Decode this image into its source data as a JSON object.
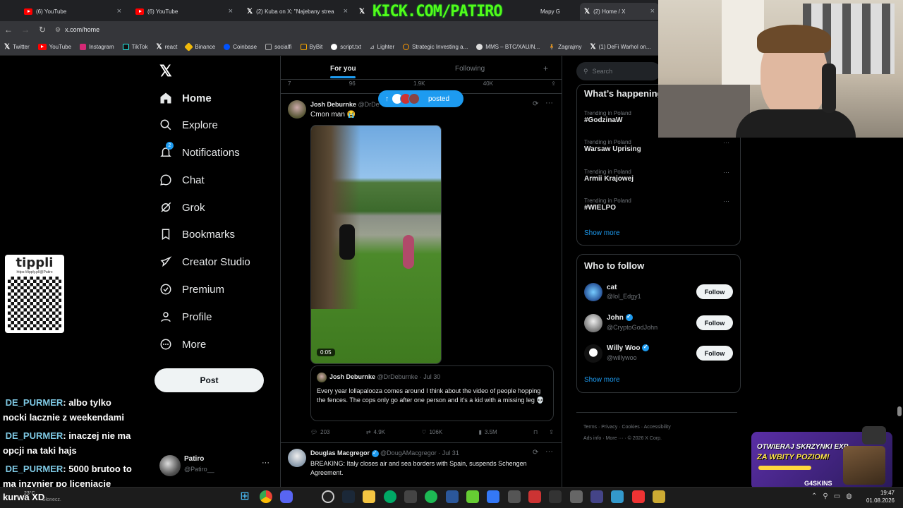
{
  "browser": {
    "tabs": [
      {
        "label": "(6) YouTube",
        "type": "youtube"
      },
      {
        "label": "(6) YouTube",
        "type": "youtube"
      },
      {
        "label": "(2) Kuba on X: \"Najebany strea",
        "type": "x"
      },
      {
        "label": "(2) Home / X",
        "type": "x"
      }
    ],
    "tab_partial_text": "Mapy G",
    "kick_overlay": "KICK.COM/PATIRO",
    "url": "x.com/home",
    "bookmarks": [
      "Twitter",
      "YouTube",
      "Instagram",
      "TikTok",
      "react",
      "Binance",
      "Coinbase",
      "socialfi",
      "ByBit",
      "script.txt",
      "Lighter",
      "Strategic Investing a...",
      "MMS – BTC/XAU/N...",
      "Zagrajmy",
      "(1) DeFi Warhol on..."
    ]
  },
  "sidebar": {
    "items": [
      {
        "label": "Home",
        "icon": "home-icon"
      },
      {
        "label": "Explore",
        "icon": "search-icon"
      },
      {
        "label": "Notifications",
        "icon": "bell-icon",
        "badge": "2"
      },
      {
        "label": "Chat",
        "icon": "chat-icon"
      },
      {
        "label": "Grok",
        "icon": "grok-icon"
      },
      {
        "label": "Bookmarks",
        "icon": "bookmark-icon"
      },
      {
        "label": "Creator Studio",
        "icon": "rocket-icon"
      },
      {
        "label": "Premium",
        "icon": "premium-icon"
      },
      {
        "label": "Profile",
        "icon": "person-icon"
      },
      {
        "label": "More",
        "icon": "more-circle-icon"
      }
    ],
    "post_label": "Post",
    "account": {
      "name": "Patiro",
      "handle": "@Patiro__"
    }
  },
  "feed": {
    "tabs": [
      "For you",
      "Following"
    ],
    "new_posts_label": "posted",
    "top_stats": [
      "7",
      "96",
      "1.9K",
      "40K"
    ],
    "post1": {
      "name": "Josh Deburnke",
      "handle": "@DrDe",
      "text": "Cmon man 😭",
      "video_time": "0:05",
      "quote": {
        "name": "Josh Deburnke",
        "handle": "@DrDeburnke",
        "date": "· Jul 30",
        "text": "Every year lollapalooza comes around I think about the video of people hopping the fences. The cops only go after one person and it’s a kid with a missing leg 💀"
      },
      "stats": {
        "replies": "203",
        "reposts": "4.9K",
        "likes": "106K",
        "views": "3.5M"
      }
    },
    "post2": {
      "name": "Douglas Macgregor",
      "handle": "@DougAMacgregor",
      "date": "· Jul 31",
      "text": "BREAKING: Italy closes air and sea borders with Spain, suspends Schengen Agreement."
    }
  },
  "right": {
    "search_placeholder": "Search",
    "trends_title": "What’s happening",
    "trends": [
      {
        "sub": "Trending in Poland",
        "title": "#GodzinaW"
      },
      {
        "sub": "Trending in Poland",
        "title": "Warsaw Uprising"
      },
      {
        "sub": "Trending in Poland",
        "title": "Armii Krajowej"
      },
      {
        "sub": "Trending in Poland",
        "title": "#WIELPO"
      }
    ],
    "show_more": "Show more",
    "who_title": "Who to follow",
    "follow_label": "Follow",
    "who": [
      {
        "name": "cat",
        "handle": "@lol_Edgy1",
        "verified": false
      },
      {
        "name": "John",
        "handle": "@CryptoGodJohn",
        "verified": true
      },
      {
        "name": "Willy Woo",
        "handle": "@willywoo",
        "verified": true
      }
    ],
    "footer": [
      "Terms",
      "Privacy",
      "Cookies",
      "Accessibility",
      "Ads info",
      "More ···",
      "© 2026 X Corp."
    ]
  },
  "overlay": {
    "tipply": "tippli",
    "tipply_url": "https://tipply.pl/@Patiro",
    "chat": [
      {
        "user": "DE_PURMER",
        "msg": ": albo tylko"
      },
      {
        "line": "nocki lacznie z weekendami"
      },
      {
        "user": "DE_PURMER",
        "msg": ": inaczej nie ma"
      },
      {
        "line": "opcji na taki hajs"
      },
      {
        "user": "DE_PURMER",
        "msg": ": 5000 brutoo to"
      },
      {
        "line": "ma inzynier po licenjacie"
      },
      {
        "line": "kurwa XD"
      }
    ],
    "promo_line1": "OTWIERAJ SKRZYNKI EXP",
    "promo_line2": "ZA WBITY POZIOM!",
    "promo_brand": "G4SKINS"
  },
  "taskbar": {
    "weather": "23°C",
    "weather_sub": "Słonecz.",
    "time": "19:47",
    "date": "01.08.2026"
  }
}
